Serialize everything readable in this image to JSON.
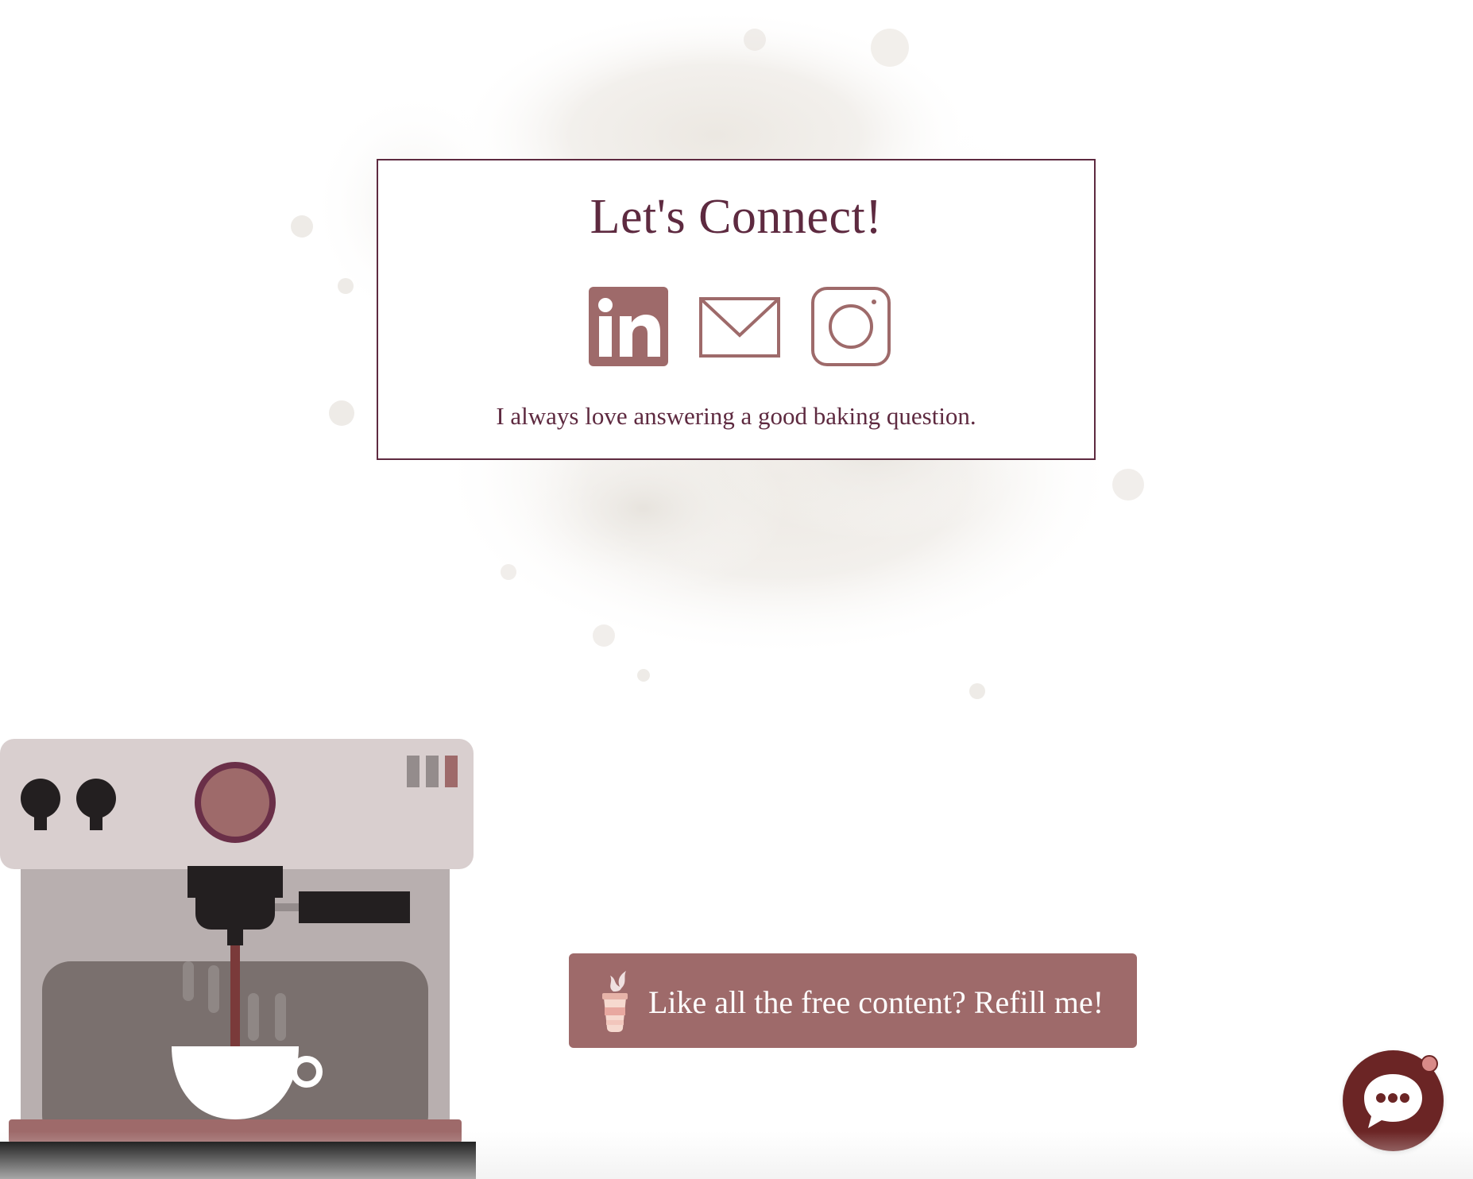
{
  "connect_card": {
    "title": "Let's Connect!",
    "subtitle": "I always love answering a good baking question.",
    "social_links": [
      {
        "name": "linkedin",
        "icon": "linkedin-icon"
      },
      {
        "name": "email",
        "icon": "mail-icon"
      },
      {
        "name": "instagram",
        "icon": "instagram-icon"
      }
    ]
  },
  "refill_button": {
    "label": "Like all the free content? Refill me!",
    "icon": "coffee-cup-icon"
  },
  "chat_button": {
    "icon": "chat-bubble-icon",
    "has_notification": true
  },
  "illustration": {
    "icon": "espresso-machine-illustration"
  },
  "colors": {
    "brand_dark": "#5e2a40",
    "brand_muted": "#9e6a6a",
    "chat_bg": "#6b2525",
    "notification": "#d98a88"
  }
}
